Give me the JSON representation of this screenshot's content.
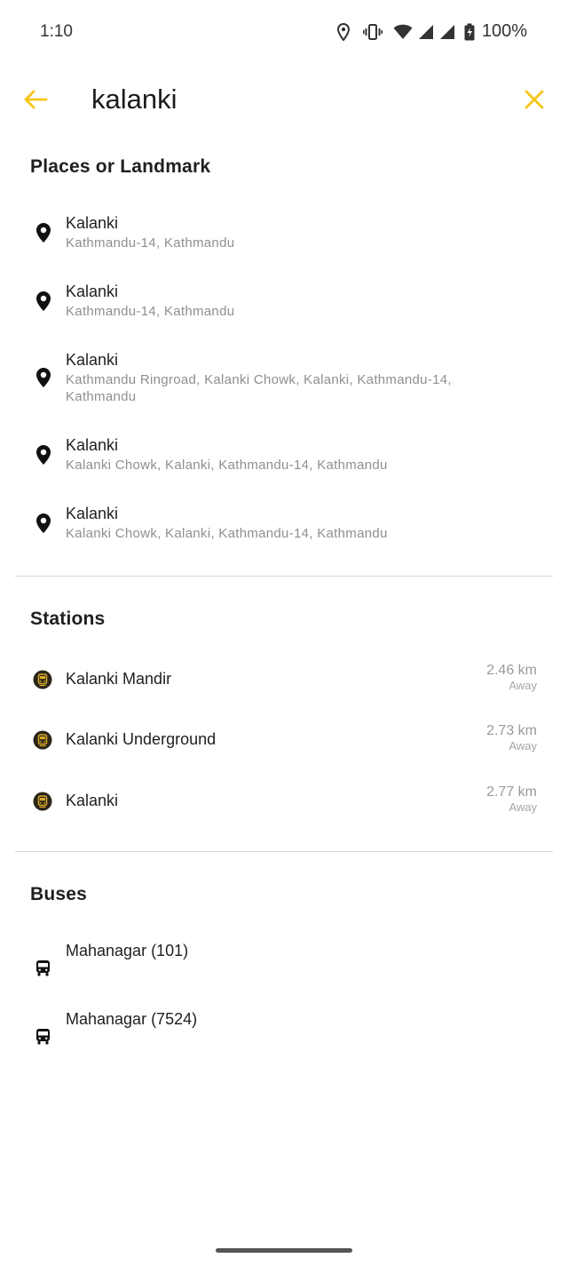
{
  "status_bar": {
    "time": "1:10",
    "battery": "100%",
    "icons": [
      "location-icon",
      "vibrate-icon",
      "wifi-icon",
      "signal-icon",
      "signal-icon",
      "battery-icon"
    ]
  },
  "search": {
    "query": "kalanki",
    "back_icon": "arrow-left-icon",
    "clear_icon": "close-icon",
    "accent_color": "#f5c518"
  },
  "places": {
    "title": "Places or Landmark",
    "items": [
      {
        "name": "Kalanki",
        "address": "Kathmandu-14, Kathmandu"
      },
      {
        "name": "Kalanki",
        "address": "Kathmandu-14, Kathmandu"
      },
      {
        "name": "Kalanki",
        "address": "Kathmandu Ringroad, Kalanki Chowk, Kalanki, Kathmandu-14, Kathmandu"
      },
      {
        "name": "Kalanki",
        "address": "Kalanki Chowk, Kalanki, Kathmandu-14, Kathmandu"
      },
      {
        "name": "Kalanki",
        "address": "Kalanki Chowk, Kalanki, Kathmandu-14, Kathmandu"
      }
    ]
  },
  "stations": {
    "title": "Stations",
    "items": [
      {
        "name": "Kalanki Mandir",
        "distance": "2.46 km",
        "away_label": "Away"
      },
      {
        "name": "Kalanki Underground",
        "distance": "2.73 km",
        "away_label": "Away"
      },
      {
        "name": "Kalanki",
        "distance": "2.77 km",
        "away_label": "Away"
      }
    ]
  },
  "buses": {
    "title": "Buses",
    "items": [
      {
        "name": "Mahanagar (101)"
      },
      {
        "name": "Mahanagar (7524)"
      }
    ]
  }
}
